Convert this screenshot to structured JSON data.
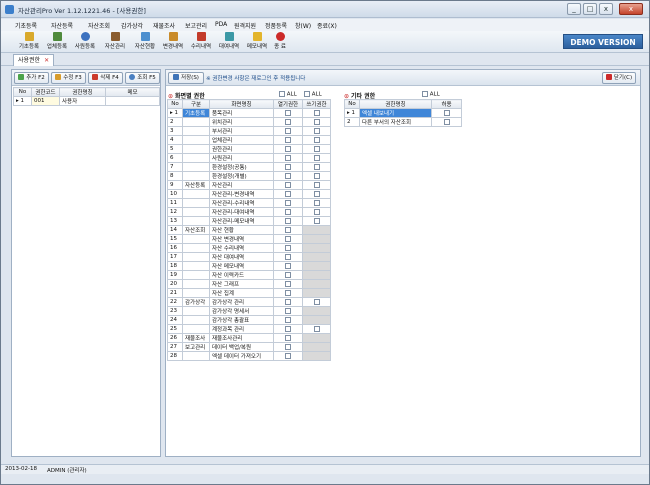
{
  "window": {
    "title": "자산관리Pro Ver 1.12.1221.46 - [사용권한]",
    "buttons": [
      "_",
      "□",
      "x",
      "x"
    ]
  },
  "menu": [
    "기초등록",
    "자산등록",
    "자산조회",
    "감가상각",
    "재물조사",
    "보고관리",
    "PDA",
    "원격지원",
    "정품등록",
    "창(W)",
    "종료(X)"
  ],
  "toolbar": {
    "items": [
      {
        "label": "기초등록",
        "icon": "folder-icon",
        "color": "#d9a92b"
      },
      {
        "label": "업체등록",
        "icon": "building-icon",
        "color": "#4f8a3c"
      },
      {
        "label": "사원등록",
        "icon": "person-icon",
        "color": "#3c72c0"
      },
      {
        "label": "자산관리",
        "icon": "box-icon",
        "color": "#8a5c2f"
      },
      {
        "label": "자산현황",
        "icon": "list-icon",
        "color": "#4d8fcf"
      },
      {
        "label": "변경내역",
        "icon": "pencil-icon",
        "color": "#c98b2a"
      },
      {
        "label": "수리내역",
        "icon": "wrench-icon",
        "color": "#c33b2b"
      },
      {
        "label": "대여내역",
        "icon": "swap-icon",
        "color": "#3c99a6"
      },
      {
        "label": "메모내역",
        "icon": "note-icon",
        "color": "#e3b52c"
      },
      {
        "label": "종 료",
        "icon": "power-icon",
        "color": "#cc2a2a"
      }
    ],
    "demo": "DEMO VERSION"
  },
  "tab": {
    "label": "사용권한"
  },
  "left": {
    "buttons": {
      "add": "추가 F2",
      "edit": "수정 F3",
      "delete": "삭제 F4",
      "search": "조회 F5"
    },
    "columns": [
      "No",
      "권한코드",
      "권한명칭",
      "메모"
    ],
    "rows": [
      {
        "no": "1",
        "code": "001",
        "name": "사용자",
        "memo": ""
      }
    ]
  },
  "right": {
    "save_label": "저장(S)",
    "notice": "※ 권한변경 사항은 재로그인 후 적용됩니다",
    "close_label": "닫기(C)",
    "screen_title": "화면별 권한",
    "all_label": "ALL",
    "screen_columns": [
      "No",
      "구분",
      "화면명칭",
      "열기권한",
      "쓰기권한"
    ],
    "screen_rows": [
      {
        "no": "1",
        "cat": "기초등록",
        "name": "품목관리",
        "write": true
      },
      {
        "no": "2",
        "cat": "",
        "name": "위치관리",
        "write": true
      },
      {
        "no": "3",
        "cat": "",
        "name": "부서관리",
        "write": true
      },
      {
        "no": "4",
        "cat": "",
        "name": "업체관리",
        "write": true
      },
      {
        "no": "5",
        "cat": "",
        "name": "권한관리",
        "write": true
      },
      {
        "no": "6",
        "cat": "",
        "name": "사원관리",
        "write": true
      },
      {
        "no": "7",
        "cat": "",
        "name": "환경설정(공통)",
        "write": true
      },
      {
        "no": "8",
        "cat": "",
        "name": "환경설정(개별)",
        "write": true
      },
      {
        "no": "9",
        "cat": "자산등록",
        "name": "자산관리",
        "write": true
      },
      {
        "no": "10",
        "cat": "",
        "name": "자산관리-변경내역",
        "write": true
      },
      {
        "no": "11",
        "cat": "",
        "name": "자산관리-수리내역",
        "write": true
      },
      {
        "no": "12",
        "cat": "",
        "name": "자산관리-대여내역",
        "write": true
      },
      {
        "no": "13",
        "cat": "",
        "name": "자산관리-메모내역",
        "write": true
      },
      {
        "no": "14",
        "cat": "자산조회",
        "name": "자산 현황",
        "write": false
      },
      {
        "no": "15",
        "cat": "",
        "name": "자산 변경내역",
        "write": false
      },
      {
        "no": "16",
        "cat": "",
        "name": "자산 수리내역",
        "write": false
      },
      {
        "no": "17",
        "cat": "",
        "name": "자산 대여내역",
        "write": false
      },
      {
        "no": "18",
        "cat": "",
        "name": "자산 메모내역",
        "write": false
      },
      {
        "no": "19",
        "cat": "",
        "name": "자산 이력카드",
        "write": false
      },
      {
        "no": "20",
        "cat": "",
        "name": "자산 그래프",
        "write": false
      },
      {
        "no": "21",
        "cat": "",
        "name": "자산 집계",
        "write": false
      },
      {
        "no": "22",
        "cat": "감가상각",
        "name": "감가상각 관리",
        "write": true
      },
      {
        "no": "23",
        "cat": "",
        "name": "감가상각 명세서",
        "write": false
      },
      {
        "no": "24",
        "cat": "",
        "name": "감가상각 총괄표",
        "write": false
      },
      {
        "no": "25",
        "cat": "",
        "name": "계정과목 관리",
        "write": true
      },
      {
        "no": "26",
        "cat": "재물조사",
        "name": "재물조사관리",
        "write": false
      },
      {
        "no": "27",
        "cat": "보고관리",
        "name": "데이터 백업/복원",
        "write": false
      },
      {
        "no": "28",
        "cat": "",
        "name": "엑셀 데이터 가져오기",
        "write": false
      }
    ],
    "other_title": "기타 권한",
    "other_columns": [
      "No",
      "권한명칭",
      "허용"
    ],
    "other_rows": [
      {
        "no": "1",
        "name": "엑셀 내보내기"
      },
      {
        "no": "2",
        "name": "다른 부서의 자산조회"
      }
    ]
  },
  "status": {
    "date": "2013-02-18",
    "user": "ADMIN (관리자)"
  }
}
